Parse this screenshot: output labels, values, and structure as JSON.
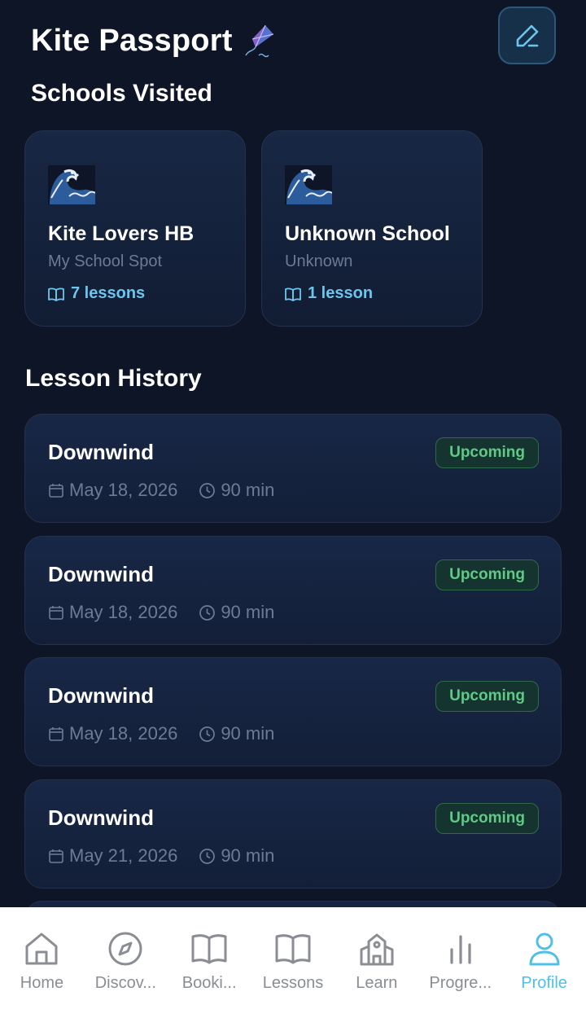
{
  "header": {
    "title": "Kite Passport",
    "title_icon": "kite-icon",
    "edit_icon": "pencil-icon"
  },
  "schools": {
    "title": "Schools Visited",
    "items": [
      {
        "icon": "wave-icon",
        "name": "Kite Lovers HB",
        "spot": "My School Spot",
        "lessons": "7 lessons"
      },
      {
        "icon": "wave-icon",
        "name": "Unknown School",
        "spot": "Unknown",
        "lessons": "1 lesson"
      }
    ]
  },
  "history": {
    "title": "Lesson History",
    "items": [
      {
        "title": "Downwind",
        "status": "Upcoming",
        "date": "May 18, 2026",
        "duration": "90 min"
      },
      {
        "title": "Downwind",
        "status": "Upcoming",
        "date": "May 18, 2026",
        "duration": "90 min"
      },
      {
        "title": "Downwind",
        "status": "Upcoming",
        "date": "May 18, 2026",
        "duration": "90 min"
      },
      {
        "title": "Downwind",
        "status": "Upcoming",
        "date": "May 21, 2026",
        "duration": "90 min"
      }
    ]
  },
  "tabbar": {
    "tabs": [
      {
        "label": "Home",
        "icon": "home-icon"
      },
      {
        "label": "Discov...",
        "icon": "compass-icon"
      },
      {
        "label": "Booki...",
        "icon": "book-icon"
      },
      {
        "label": "Lessons",
        "icon": "book-icon"
      },
      {
        "label": "Learn",
        "icon": "school-icon"
      },
      {
        "label": "Progre...",
        "icon": "bar-chart-icon"
      },
      {
        "label": "Profile",
        "icon": "person-icon"
      }
    ],
    "active": "Profile"
  },
  "colors": {
    "background": "#0d1527",
    "accent": "#4fc0ea",
    "upcoming_badge": "#5fc985",
    "muted_text": "#6d7b93"
  }
}
